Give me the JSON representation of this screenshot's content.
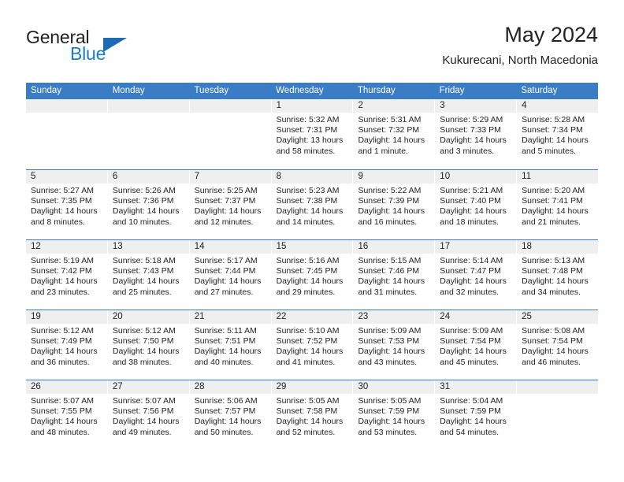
{
  "brand": {
    "name_part1": "General",
    "name_part2": "Blue",
    "logo_icon": "triangle-logo-icon"
  },
  "header": {
    "title": "May 2024",
    "location": "Kukurecani, North Macedonia"
  },
  "calendar": {
    "weekdays": [
      "Sunday",
      "Monday",
      "Tuesday",
      "Wednesday",
      "Thursday",
      "Friday",
      "Saturday"
    ],
    "header_bg": "#3b7dc4",
    "daynum_bg": "#efefef",
    "weeks": [
      [
        {
          "day": "",
          "empty": true,
          "sunrise": "",
          "sunset": "",
          "daylight1": "",
          "daylight2": ""
        },
        {
          "day": "",
          "empty": true,
          "sunrise": "",
          "sunset": "",
          "daylight1": "",
          "daylight2": ""
        },
        {
          "day": "",
          "empty": true,
          "sunrise": "",
          "sunset": "",
          "daylight1": "",
          "daylight2": ""
        },
        {
          "day": "1",
          "empty": false,
          "sunrise": "Sunrise: 5:32 AM",
          "sunset": "Sunset: 7:31 PM",
          "daylight1": "Daylight: 13 hours",
          "daylight2": "and 58 minutes."
        },
        {
          "day": "2",
          "empty": false,
          "sunrise": "Sunrise: 5:31 AM",
          "sunset": "Sunset: 7:32 PM",
          "daylight1": "Daylight: 14 hours",
          "daylight2": "and 1 minute."
        },
        {
          "day": "3",
          "empty": false,
          "sunrise": "Sunrise: 5:29 AM",
          "sunset": "Sunset: 7:33 PM",
          "daylight1": "Daylight: 14 hours",
          "daylight2": "and 3 minutes."
        },
        {
          "day": "4",
          "empty": false,
          "sunrise": "Sunrise: 5:28 AM",
          "sunset": "Sunset: 7:34 PM",
          "daylight1": "Daylight: 14 hours",
          "daylight2": "and 5 minutes."
        }
      ],
      [
        {
          "day": "5",
          "empty": false,
          "sunrise": "Sunrise: 5:27 AM",
          "sunset": "Sunset: 7:35 PM",
          "daylight1": "Daylight: 14 hours",
          "daylight2": "and 8 minutes."
        },
        {
          "day": "6",
          "empty": false,
          "sunrise": "Sunrise: 5:26 AM",
          "sunset": "Sunset: 7:36 PM",
          "daylight1": "Daylight: 14 hours",
          "daylight2": "and 10 minutes."
        },
        {
          "day": "7",
          "empty": false,
          "sunrise": "Sunrise: 5:25 AM",
          "sunset": "Sunset: 7:37 PM",
          "daylight1": "Daylight: 14 hours",
          "daylight2": "and 12 minutes."
        },
        {
          "day": "8",
          "empty": false,
          "sunrise": "Sunrise: 5:23 AM",
          "sunset": "Sunset: 7:38 PM",
          "daylight1": "Daylight: 14 hours",
          "daylight2": "and 14 minutes."
        },
        {
          "day": "9",
          "empty": false,
          "sunrise": "Sunrise: 5:22 AM",
          "sunset": "Sunset: 7:39 PM",
          "daylight1": "Daylight: 14 hours",
          "daylight2": "and 16 minutes."
        },
        {
          "day": "10",
          "empty": false,
          "sunrise": "Sunrise: 5:21 AM",
          "sunset": "Sunset: 7:40 PM",
          "daylight1": "Daylight: 14 hours",
          "daylight2": "and 18 minutes."
        },
        {
          "day": "11",
          "empty": false,
          "sunrise": "Sunrise: 5:20 AM",
          "sunset": "Sunset: 7:41 PM",
          "daylight1": "Daylight: 14 hours",
          "daylight2": "and 21 minutes."
        }
      ],
      [
        {
          "day": "12",
          "empty": false,
          "sunrise": "Sunrise: 5:19 AM",
          "sunset": "Sunset: 7:42 PM",
          "daylight1": "Daylight: 14 hours",
          "daylight2": "and 23 minutes."
        },
        {
          "day": "13",
          "empty": false,
          "sunrise": "Sunrise: 5:18 AM",
          "sunset": "Sunset: 7:43 PM",
          "daylight1": "Daylight: 14 hours",
          "daylight2": "and 25 minutes."
        },
        {
          "day": "14",
          "empty": false,
          "sunrise": "Sunrise: 5:17 AM",
          "sunset": "Sunset: 7:44 PM",
          "daylight1": "Daylight: 14 hours",
          "daylight2": "and 27 minutes."
        },
        {
          "day": "15",
          "empty": false,
          "sunrise": "Sunrise: 5:16 AM",
          "sunset": "Sunset: 7:45 PM",
          "daylight1": "Daylight: 14 hours",
          "daylight2": "and 29 minutes."
        },
        {
          "day": "16",
          "empty": false,
          "sunrise": "Sunrise: 5:15 AM",
          "sunset": "Sunset: 7:46 PM",
          "daylight1": "Daylight: 14 hours",
          "daylight2": "and 31 minutes."
        },
        {
          "day": "17",
          "empty": false,
          "sunrise": "Sunrise: 5:14 AM",
          "sunset": "Sunset: 7:47 PM",
          "daylight1": "Daylight: 14 hours",
          "daylight2": "and 32 minutes."
        },
        {
          "day": "18",
          "empty": false,
          "sunrise": "Sunrise: 5:13 AM",
          "sunset": "Sunset: 7:48 PM",
          "daylight1": "Daylight: 14 hours",
          "daylight2": "and 34 minutes."
        }
      ],
      [
        {
          "day": "19",
          "empty": false,
          "sunrise": "Sunrise: 5:12 AM",
          "sunset": "Sunset: 7:49 PM",
          "daylight1": "Daylight: 14 hours",
          "daylight2": "and 36 minutes."
        },
        {
          "day": "20",
          "empty": false,
          "sunrise": "Sunrise: 5:12 AM",
          "sunset": "Sunset: 7:50 PM",
          "daylight1": "Daylight: 14 hours",
          "daylight2": "and 38 minutes."
        },
        {
          "day": "21",
          "empty": false,
          "sunrise": "Sunrise: 5:11 AM",
          "sunset": "Sunset: 7:51 PM",
          "daylight1": "Daylight: 14 hours",
          "daylight2": "and 40 minutes."
        },
        {
          "day": "22",
          "empty": false,
          "sunrise": "Sunrise: 5:10 AM",
          "sunset": "Sunset: 7:52 PM",
          "daylight1": "Daylight: 14 hours",
          "daylight2": "and 41 minutes."
        },
        {
          "day": "23",
          "empty": false,
          "sunrise": "Sunrise: 5:09 AM",
          "sunset": "Sunset: 7:53 PM",
          "daylight1": "Daylight: 14 hours",
          "daylight2": "and 43 minutes."
        },
        {
          "day": "24",
          "empty": false,
          "sunrise": "Sunrise: 5:09 AM",
          "sunset": "Sunset: 7:54 PM",
          "daylight1": "Daylight: 14 hours",
          "daylight2": "and 45 minutes."
        },
        {
          "day": "25",
          "empty": false,
          "sunrise": "Sunrise: 5:08 AM",
          "sunset": "Sunset: 7:54 PM",
          "daylight1": "Daylight: 14 hours",
          "daylight2": "and 46 minutes."
        }
      ],
      [
        {
          "day": "26",
          "empty": false,
          "sunrise": "Sunrise: 5:07 AM",
          "sunset": "Sunset: 7:55 PM",
          "daylight1": "Daylight: 14 hours",
          "daylight2": "and 48 minutes."
        },
        {
          "day": "27",
          "empty": false,
          "sunrise": "Sunrise: 5:07 AM",
          "sunset": "Sunset: 7:56 PM",
          "daylight1": "Daylight: 14 hours",
          "daylight2": "and 49 minutes."
        },
        {
          "day": "28",
          "empty": false,
          "sunrise": "Sunrise: 5:06 AM",
          "sunset": "Sunset: 7:57 PM",
          "daylight1": "Daylight: 14 hours",
          "daylight2": "and 50 minutes."
        },
        {
          "day": "29",
          "empty": false,
          "sunrise": "Sunrise: 5:05 AM",
          "sunset": "Sunset: 7:58 PM",
          "daylight1": "Daylight: 14 hours",
          "daylight2": "and 52 minutes."
        },
        {
          "day": "30",
          "empty": false,
          "sunrise": "Sunrise: 5:05 AM",
          "sunset": "Sunset: 7:59 PM",
          "daylight1": "Daylight: 14 hours",
          "daylight2": "and 53 minutes."
        },
        {
          "day": "31",
          "empty": false,
          "sunrise": "Sunrise: 5:04 AM",
          "sunset": "Sunset: 7:59 PM",
          "daylight1": "Daylight: 14 hours",
          "daylight2": "and 54 minutes."
        },
        {
          "day": "",
          "empty": true,
          "sunrise": "",
          "sunset": "",
          "daylight1": "",
          "daylight2": ""
        }
      ]
    ]
  }
}
